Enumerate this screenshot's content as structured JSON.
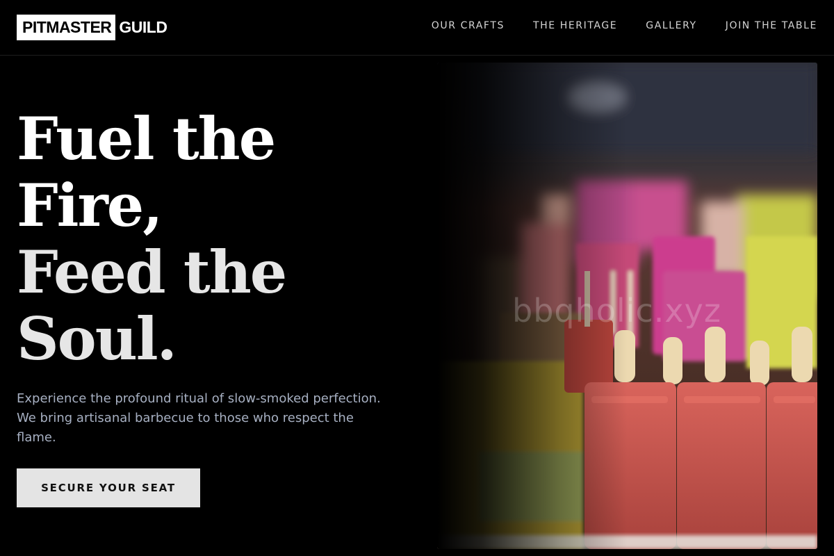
{
  "brand": {
    "boxed": "PITMASTER",
    "rest": "GUILD"
  },
  "nav": {
    "items": [
      {
        "label": "OUR CRAFTS"
      },
      {
        "label": "THE HERITAGE"
      },
      {
        "label": "GALLERY"
      },
      {
        "label": "JOIN THE TABLE"
      }
    ]
  },
  "hero": {
    "title_lines": [
      "Fuel the",
      "Fire,",
      "Feed the",
      "Soul."
    ],
    "subtitle": "Experience the profound ritual of slow-smoked perfection. We bring artisanal barbecue to those who respect the flame.",
    "cta_label": "SECURE YOUR SEAT",
    "image": {
      "subject": "popsicles-display",
      "watermark": "bbqholic.xyz"
    }
  }
}
